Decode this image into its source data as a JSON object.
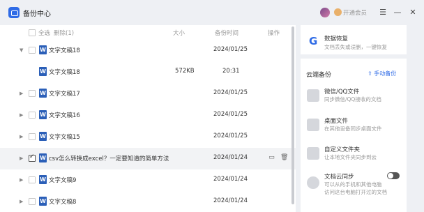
{
  "app": {
    "title": "备份中心"
  },
  "titlebar": {
    "vip_label": "开通会员"
  },
  "list": {
    "header": {
      "select_all": "全选",
      "delete": "删除(1)",
      "size": "大小",
      "time": "备份时间",
      "action": "操作"
    },
    "rows": [
      {
        "name": "文字文稿18",
        "size": "",
        "time": "2024/01/25",
        "expanded": true,
        "checked": false
      },
      {
        "name": "文字文稿18",
        "size": "572KB",
        "time": "20:31",
        "child": true,
        "checked": false
      },
      {
        "name": "文字文稿17",
        "size": "",
        "time": "2024/01/25",
        "checked": false
      },
      {
        "name": "文字文稿16",
        "size": "",
        "time": "2024/01/25",
        "checked": false
      },
      {
        "name": "文字文稿15",
        "size": "",
        "time": "2024/01/25",
        "checked": false
      },
      {
        "name": "csv怎么转换成excel？一定要知道的简单方法",
        "size": "",
        "time": "2024/01/24",
        "checked": true,
        "selected": true
      },
      {
        "name": "文字文稿9",
        "size": "",
        "time": "2024/01/24",
        "checked": false
      },
      {
        "name": "文字文稿8",
        "size": "",
        "time": "2024/01/24",
        "checked": false
      }
    ]
  },
  "side": {
    "recover": {
      "title": "数据恢复",
      "subtitle": "文档丢失或误删，一键恢复"
    },
    "cloud_backup": {
      "title": "云端备份",
      "manual_label": "手动备份"
    },
    "items": [
      {
        "title": "微信/QQ文件",
        "subtitle": "同步微信/QQ接收的文档"
      },
      {
        "title": "桌面文件",
        "subtitle": "在其他设备同步桌面文件"
      },
      {
        "title": "自定义文件夹",
        "subtitle": "让本地文件夹同步到云"
      },
      {
        "title": "文档云同步",
        "subtitle": "可以从的手机和其他电脑",
        "subtitle2": "访问这台电脑打开过的文档",
        "toggle": true
      }
    ]
  }
}
